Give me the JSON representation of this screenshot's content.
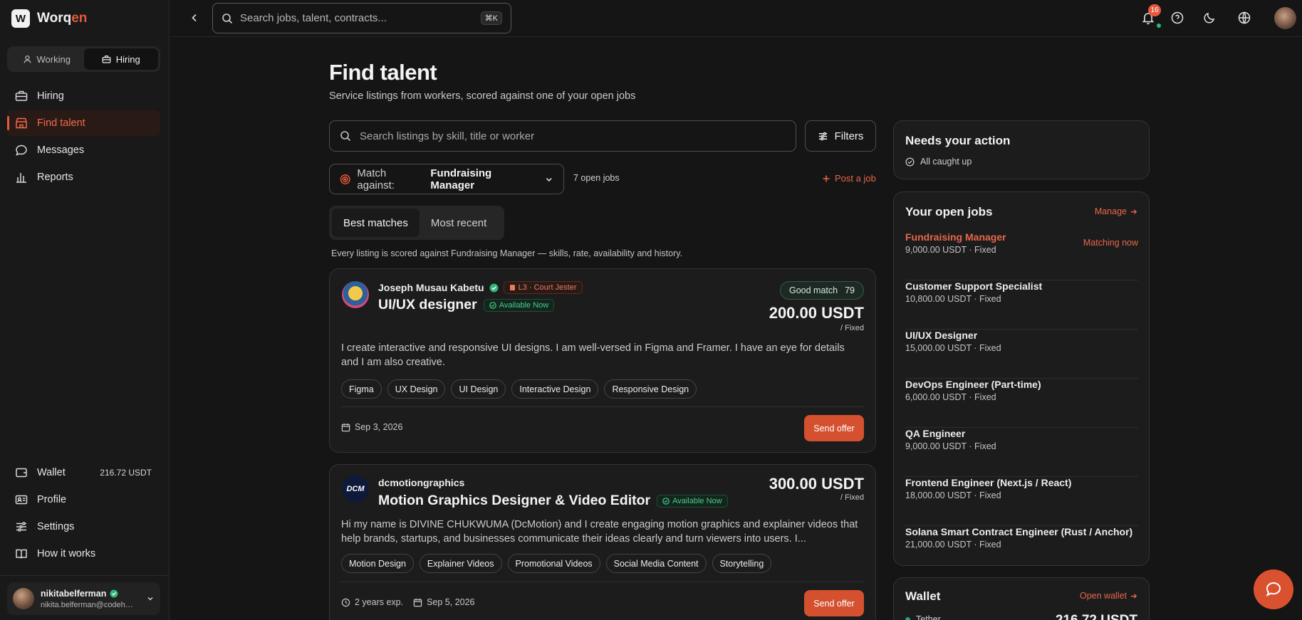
{
  "brand": {
    "name_main": "Worq",
    "name_accent": "en"
  },
  "mode_switch": {
    "working": "Working",
    "hiring": "Hiring"
  },
  "nav": [
    {
      "label": "Hiring",
      "icon": "briefcase-icon"
    },
    {
      "label": "Find talent",
      "icon": "storefront-icon",
      "active": true
    },
    {
      "label": "Messages",
      "icon": "chat-icon"
    },
    {
      "label": "Reports",
      "icon": "bar-chart-icon"
    }
  ],
  "bottom_nav": {
    "wallet": {
      "label": "Wallet",
      "value": "216.72 USDT"
    },
    "profile": "Profile",
    "settings": "Settings",
    "how_it_works": "How it works"
  },
  "user": {
    "name": "nikitabelferman",
    "email": "nikita.belferman@codehiv..."
  },
  "topbar": {
    "search_placeholder": "Search jobs, talent, contracts...",
    "shortcut": "⌘K",
    "notifications": "16"
  },
  "page": {
    "title": "Find talent",
    "subtitle": "Service listings from workers, scored against one of your open jobs"
  },
  "listing_search": {
    "placeholder": "Search listings by skill, title or worker"
  },
  "filters_label": "Filters",
  "match": {
    "label": "Match against:",
    "value": "Fundraising Manager",
    "open_jobs": "7 open jobs",
    "post_job": "Post a job"
  },
  "sort_tabs": {
    "best": "Best matches",
    "recent": "Most recent"
  },
  "scored_note": "Every listing is scored against Fundraising Manager — skills, rate, availability and history.",
  "listings": [
    {
      "worker": "Joseph Musau Kabetu",
      "level": "L3 · Court Jester",
      "title": "UI/UX designer",
      "availability": "Available Now",
      "match_label": "Good match",
      "match_score": "79",
      "price": "200.00 USDT",
      "price_unit": "/ Fixed",
      "description": "I create interactive and responsive UI designs. I am well-versed in Figma and Framer. I have an eye for details and I am also creative.",
      "tags": [
        "Figma",
        "UX Design",
        "UI Design",
        "Interactive Design",
        "Responsive Design"
      ],
      "date": "Sep 3, 2026",
      "cta": "Send offer"
    },
    {
      "worker": "dcmotiongraphics",
      "avatar_text": "DCM",
      "title": "Motion Graphics Designer & Video Editor",
      "availability": "Available Now",
      "price": "300.00 USDT",
      "price_unit": "/ Fixed",
      "description": "Hi my name is DIVINE CHUKWUMA (DcMotion) and I create engaging motion graphics and explainer videos that help brands, startups, and businesses communicate their ideas clearly and turn viewers into users. I...",
      "tags": [
        "Motion Design",
        "Explainer Videos",
        "Promotional Videos",
        "Social Media Content",
        "Storytelling"
      ],
      "experience": "2 years exp.",
      "date": "Sep 5, 2026",
      "cta": "Send offer"
    }
  ],
  "action_panel": {
    "title": "Needs your action",
    "status": "All caught up"
  },
  "jobs_panel": {
    "title": "Your open jobs",
    "link": "Manage",
    "jobs": [
      {
        "name": "Fundraising Manager",
        "meta": "9,000.00 USDT  ·  Fixed",
        "status": "Matching now"
      },
      {
        "name": "Customer Support Specialist",
        "meta": "10,800.00 USDT  ·  Fixed"
      },
      {
        "name": "UI/UX Designer",
        "meta": "15,000.00 USDT  ·  Fixed"
      },
      {
        "name": "DevOps Engineer (Part-time)",
        "meta": "6,000.00 USDT  ·  Fixed"
      },
      {
        "name": "QA Engineer",
        "meta": "9,000.00 USDT  ·  Fixed"
      },
      {
        "name": "Frontend Engineer (Next.js / React)",
        "meta": "18,000.00 USDT  ·  Fixed"
      },
      {
        "name": "Solana Smart Contract Engineer (Rust / Anchor)",
        "meta": "21,000.00 USDT  ·  Fixed"
      }
    ]
  },
  "wallet_panel": {
    "title": "Wallet",
    "link": "Open wallet",
    "asset": "Tether",
    "balance": "216.72 USDT"
  },
  "colors": {
    "accent": "#e55a3c",
    "success": "#4cc98b",
    "background": "#151515"
  }
}
